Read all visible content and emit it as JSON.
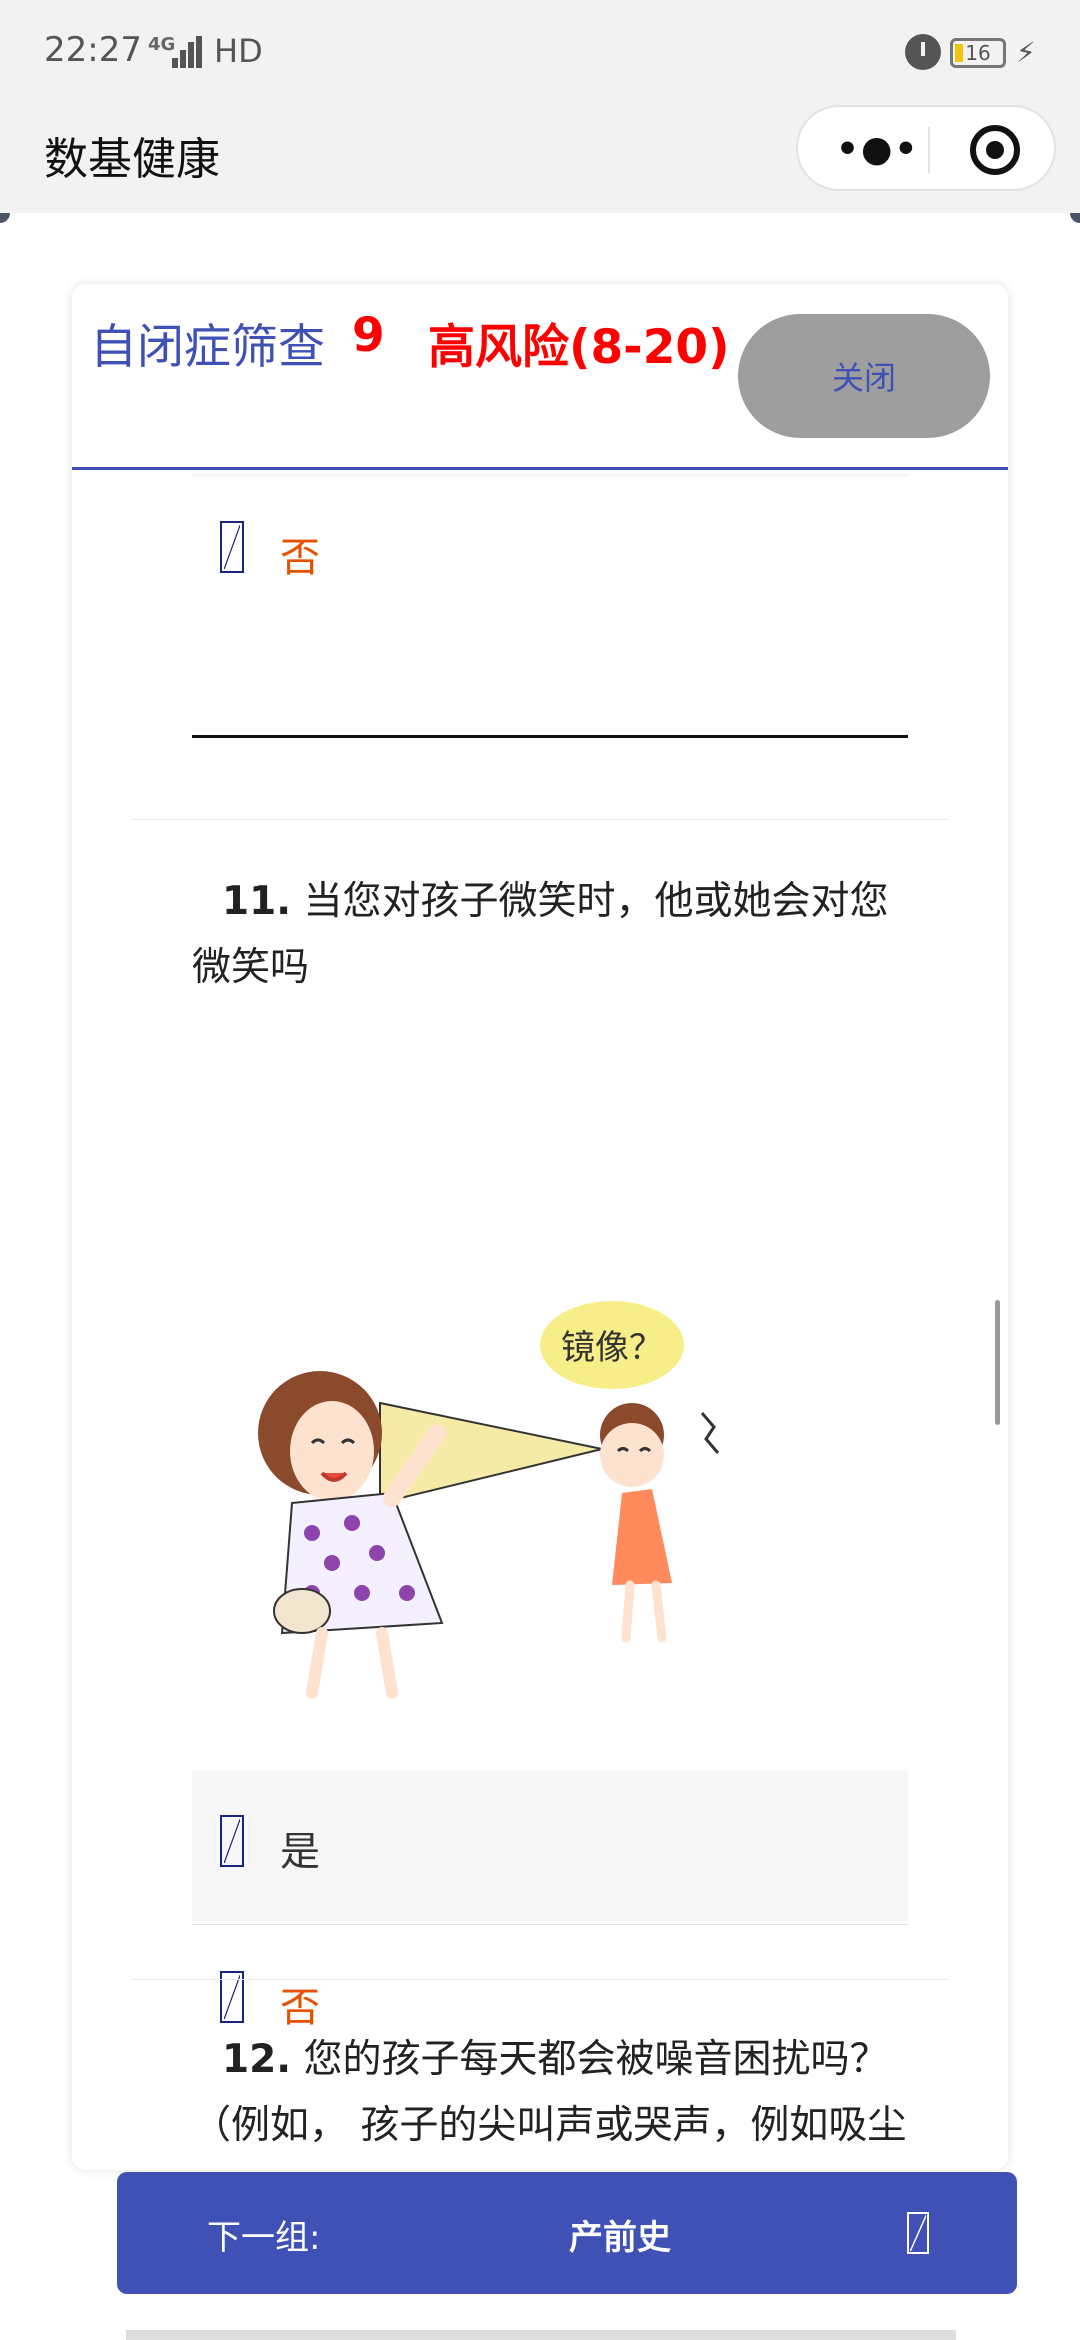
{
  "status_bar": {
    "time": "22:27",
    "network": "4G",
    "hd": "HD",
    "battery": "16"
  },
  "app": {
    "title": "数基健康",
    "more_icon": "more-dots-icon",
    "target_icon": "target-icon"
  },
  "modal": {
    "title": "自闭症筛查",
    "score": "9",
    "risk": "高风险(8-20)",
    "close_label": "关闭"
  },
  "content": {
    "q10_option_no": "否",
    "q11": {
      "number": "11.",
      "text": "当您对孩子微笑时，他或她会对您微笑吗",
      "image_text": "镜像？",
      "option_yes": "是",
      "option_no": "否"
    },
    "q12": {
      "number": "12.",
      "text": "您的孩子每天都会被噪音困扰吗？ （例如， 孩子的尖叫声或哭声，例如吸尘器或响亮的音乐？）"
    }
  },
  "next_bar": {
    "label": "下一组:",
    "target": "产前史",
    "icon": "arrow-icon"
  },
  "colors": {
    "accent": "#3f51b5",
    "risk": "#ff0000",
    "no_option": "#e65100"
  }
}
